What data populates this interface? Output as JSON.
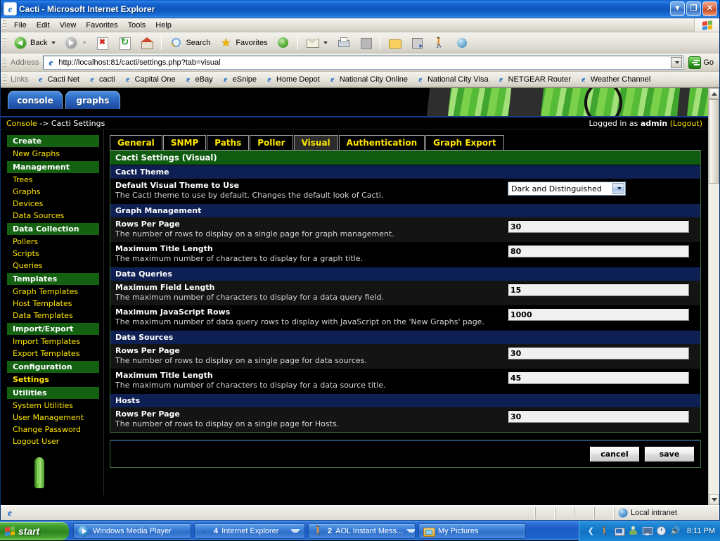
{
  "window": {
    "title": "Cacti - Microsoft Internet Explorer",
    "minimize_label": "▼",
    "maximize_label": "❐",
    "close_label": "✕"
  },
  "menubar": {
    "items": [
      "File",
      "Edit",
      "View",
      "Favorites",
      "Tools",
      "Help"
    ]
  },
  "toolbar": {
    "back_label": "Back",
    "search_label": "Search",
    "favorites_label": "Favorites"
  },
  "address": {
    "label": "Address",
    "url": "http://localhost:81/cacti/settings.php?tab=visual",
    "go_label": "Go"
  },
  "links": {
    "label": "Links",
    "items": [
      "Cacti Net",
      "cacti",
      "Capital One",
      "eBay",
      "eSnipe",
      "Home Depot",
      "National City Online",
      "National City Visa",
      "NETGEAR Router",
      "Weather Channel"
    ]
  },
  "cacti": {
    "top_tabs": [
      "console",
      "graphs"
    ],
    "breadcrumb": {
      "link": "Console",
      "separator": "->",
      "current": "Cacti Settings"
    },
    "login": {
      "text": "Logged in as",
      "user": "admin",
      "logout": "(Logout)"
    },
    "sidebar": [
      {
        "type": "header",
        "label": "Create"
      },
      {
        "type": "link",
        "label": "New Graphs",
        "active": false
      },
      {
        "type": "header",
        "label": "Management"
      },
      {
        "type": "link",
        "label": "Trees",
        "active": false
      },
      {
        "type": "link",
        "label": "Graphs",
        "active": false
      },
      {
        "type": "link",
        "label": "Devices",
        "active": false
      },
      {
        "type": "link",
        "label": "Data Sources",
        "active": false
      },
      {
        "type": "header",
        "label": "Data Collection"
      },
      {
        "type": "link",
        "label": "Pollers",
        "active": false
      },
      {
        "type": "link",
        "label": "Scripts",
        "active": false
      },
      {
        "type": "link",
        "label": "Queries",
        "active": false
      },
      {
        "type": "header",
        "label": "Templates"
      },
      {
        "type": "link",
        "label": "Graph Templates",
        "active": false
      },
      {
        "type": "link",
        "label": "Host Templates",
        "active": false
      },
      {
        "type": "link",
        "label": "Data Templates",
        "active": false
      },
      {
        "type": "header",
        "label": "Import/Export"
      },
      {
        "type": "link",
        "label": "Import Templates",
        "active": false
      },
      {
        "type": "link",
        "label": "Export Templates",
        "active": false
      },
      {
        "type": "header",
        "label": "Configuration"
      },
      {
        "type": "link",
        "label": "Settings",
        "active": true
      },
      {
        "type": "header",
        "label": "Utilities"
      },
      {
        "type": "link",
        "label": "System Utilities",
        "active": false
      },
      {
        "type": "link",
        "label": "User Management",
        "active": false
      },
      {
        "type": "link",
        "label": "Change Password",
        "active": false
      },
      {
        "type": "link",
        "label": "Logout User",
        "active": false
      }
    ],
    "settings_tabs": [
      {
        "label": "General",
        "active": false
      },
      {
        "label": "SNMP",
        "active": false
      },
      {
        "label": "Paths",
        "active": false
      },
      {
        "label": "Poller",
        "active": false
      },
      {
        "label": "Visual",
        "active": true
      },
      {
        "label": "Authentication",
        "active": false
      },
      {
        "label": "Graph Export",
        "active": false
      }
    ],
    "panel_title": "Cacti Settings (Visual)",
    "sections": [
      {
        "header": "Cacti Theme",
        "rows": [
          {
            "name": "Default Visual Theme to Use",
            "desc": "The Cacti theme to use by default. Changes the default look of Cacti.",
            "control": "select",
            "value": "Dark and Distinguished"
          }
        ]
      },
      {
        "header": "Graph Management",
        "rows": [
          {
            "name": "Rows Per Page",
            "desc": "The number of rows to display on a single page for graph management.",
            "control": "text",
            "value": "30"
          },
          {
            "name": "Maximum Title Length",
            "desc": "The maximum number of characters to display for a graph title.",
            "control": "text",
            "value": "80"
          }
        ]
      },
      {
        "header": "Data Queries",
        "rows": [
          {
            "name": "Maximum Field Length",
            "desc": "The maximum number of characters to display for a data query field.",
            "control": "text",
            "value": "15"
          },
          {
            "name": "Maximum JavaScript Rows",
            "desc": "The maximum number of data query rows to display with JavaScript on the 'New Graphs' page.",
            "control": "text",
            "value": "1000"
          }
        ]
      },
      {
        "header": "Data Sources",
        "rows": [
          {
            "name": "Rows Per Page",
            "desc": "The number of rows to display on a single page for data sources.",
            "control": "text",
            "value": "30"
          },
          {
            "name": "Maximum Title Length",
            "desc": "The maximum number of characters to display for a data source title.",
            "control": "text",
            "value": "45"
          }
        ]
      },
      {
        "header": "Hosts",
        "rows": [
          {
            "name": "Rows Per Page",
            "desc": "The number of rows to display on a single page for Hosts.",
            "control": "text",
            "value": "30"
          }
        ]
      }
    ],
    "buttons": {
      "cancel": "cancel",
      "save": "save"
    }
  },
  "statusbar": {
    "message": "",
    "zone": "Local intranet"
  },
  "taskbar": {
    "start_label": "start",
    "items": [
      {
        "label": "Windows Media Player",
        "icon": "media-player-icon",
        "count": "",
        "grouped": false
      },
      {
        "label": "Internet Explorer",
        "icon": "internet-explorer-icon",
        "count": "4",
        "grouped": true
      },
      {
        "label": "AOL Instant Mess...",
        "icon": "aim-icon",
        "count": "2",
        "grouped": true
      },
      {
        "label": "My Pictures",
        "icon": "folder-pictures-icon",
        "count": "",
        "grouped": false
      }
    ],
    "clock": "8:11 PM"
  }
}
